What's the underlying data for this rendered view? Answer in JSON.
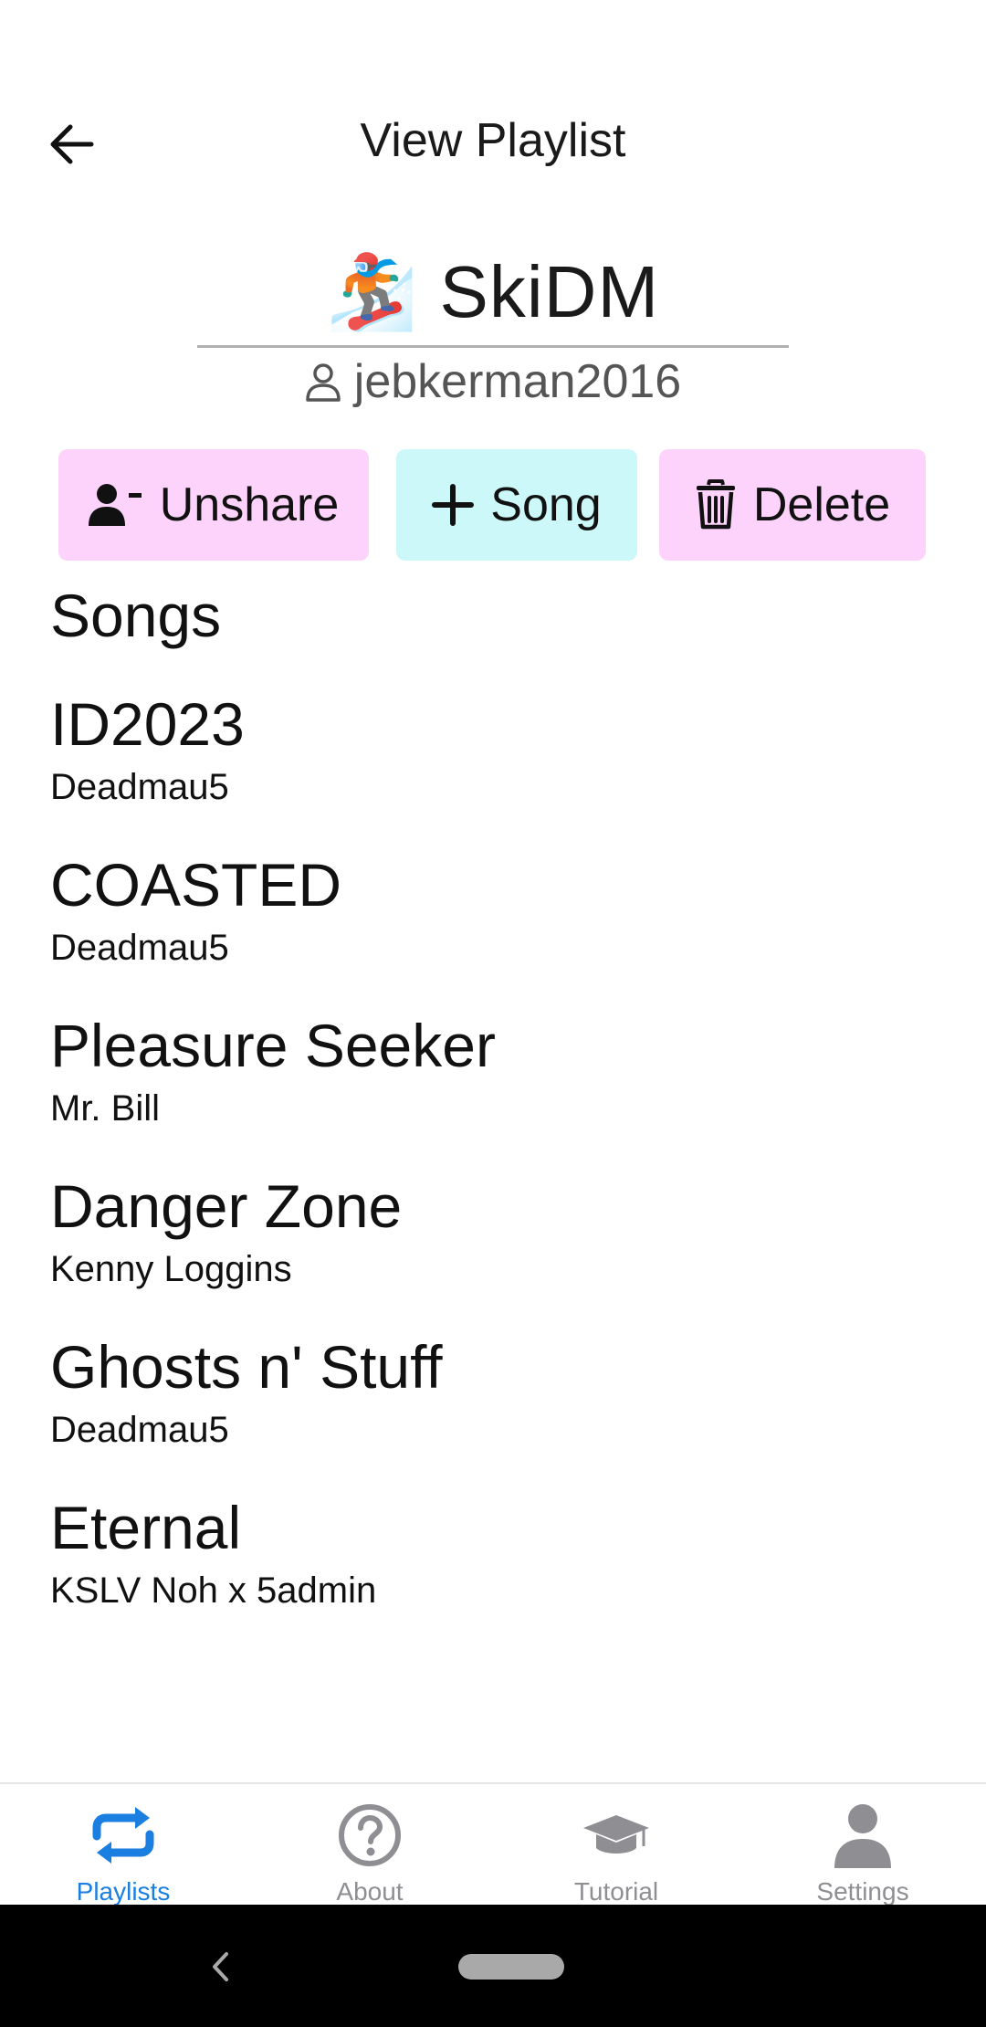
{
  "header": {
    "title": "View Playlist",
    "back_icon": "arrow-left-icon"
  },
  "playlist": {
    "emoji": "🏂",
    "name": "SkiDM",
    "owner": "jebkerman2016"
  },
  "actions": {
    "unshare_label": "Unshare",
    "song_label": "Song",
    "delete_label": "Delete",
    "colors": {
      "pink": "#fdd2fb",
      "cyan": "#ccf8fa"
    }
  },
  "songs": {
    "heading": "Songs",
    "items": [
      {
        "title": "ID2023",
        "artist": "Deadmau5"
      },
      {
        "title": "COASTED",
        "artist": "Deadmau5"
      },
      {
        "title": "Pleasure Seeker",
        "artist": "Mr. Bill"
      },
      {
        "title": "Danger Zone",
        "artist": "Kenny Loggins"
      },
      {
        "title": "Ghosts n' Stuff",
        "artist": "Deadmau5"
      },
      {
        "title": "Eternal",
        "artist": "KSLV Noh x 5admin"
      }
    ]
  },
  "tabs": [
    {
      "label": "Playlists",
      "icon": "repeat-icon",
      "active": true
    },
    {
      "label": "About",
      "icon": "question-circle-icon",
      "active": false
    },
    {
      "label": "Tutorial",
      "icon": "graduation-cap-icon",
      "active": false
    },
    {
      "label": "Settings",
      "icon": "user-icon",
      "active": false
    }
  ],
  "theme": {
    "accent": "#1a7fe0",
    "inactive": "#8e8e93"
  }
}
